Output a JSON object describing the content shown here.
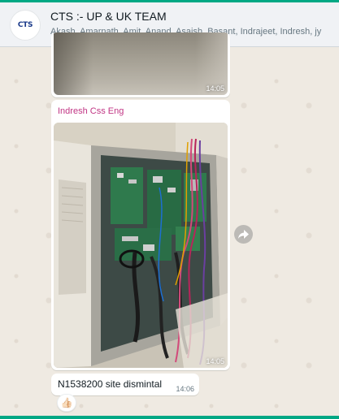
{
  "header": {
    "avatar_text": "CTS",
    "title": "CTS :- UP & UK TEAM",
    "members": "Akash, Amarnath, Amit, Anand, Asaish, Basant, Indrajeet, Indresh, jy"
  },
  "messages": [
    {
      "type": "image",
      "time": "14:05"
    },
    {
      "type": "image",
      "sender": "Indresh Css Eng",
      "time": "14:05"
    },
    {
      "type": "text",
      "text": "N1538200 site dismintal",
      "time": "14:06",
      "reaction": "👍🏻"
    }
  ],
  "icons": {
    "forward": "forward-icon"
  },
  "colors": {
    "accent": "#00a884",
    "sender_name": "#c13584",
    "chat_background": "#efeae2",
    "header_background": "#f0f2f5"
  }
}
